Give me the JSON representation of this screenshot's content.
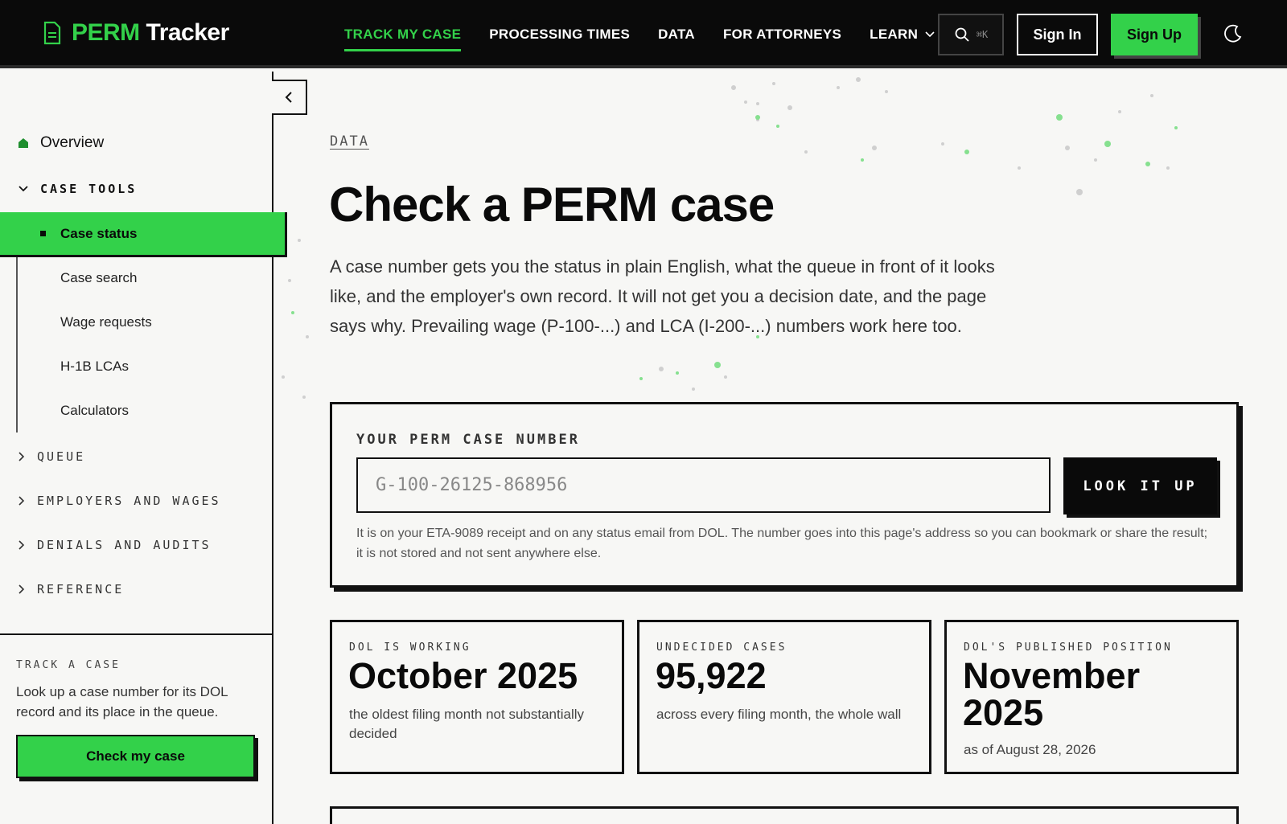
{
  "brand": {
    "part1": "PERM",
    "part2": "Tracker",
    "accent": "#33d14a"
  },
  "nav": {
    "items": [
      {
        "label": "TRACK MY CASE"
      },
      {
        "label": "PROCESSING TIMES"
      },
      {
        "label": "DATA"
      },
      {
        "label": "FOR ATTORNEYS"
      },
      {
        "label": "LEARN"
      }
    ],
    "search_shortcut": "⌘K",
    "sign_in": "Sign In",
    "sign_up": "Sign Up"
  },
  "sidebar": {
    "overview": "Overview",
    "case_tools": "CASE TOOLS",
    "case_tools_items": [
      "Case status",
      "Case search",
      "Wage requests",
      "H-1B LCAs",
      "Calculators"
    ],
    "sections": [
      "QUEUE",
      "EMPLOYERS AND WAGES",
      "DENIALS AND AUDITS",
      "REFERENCE"
    ],
    "cta": {
      "title": "TRACK A CASE",
      "text": "Look up a case number for its DOL record and its place in the queue.",
      "button": "Check my case"
    }
  },
  "main": {
    "eyebrow": "DATA",
    "title": "Check a PERM case",
    "intro": "A case number gets you the status in plain English, what the queue in front of it looks like, and the employer's own record. It will not get you a decision date, and the page says why. Prevailing wage (P-100-...) and LCA (I-200-...) numbers work here too.",
    "lookup": {
      "label": "YOUR PERM CASE NUMBER",
      "placeholder": "G-100-26125-868956",
      "button": "LOOK IT UP",
      "help": "It is on your ETA-9089 receipt and on any status email from DOL. The number goes into this page's address so you can bookmark or share the result; it is not stored and not sent anywhere else."
    },
    "stats": [
      {
        "label": "DOL IS WORKING",
        "value": "October 2025",
        "note": "the oldest filing month not substantially decided"
      },
      {
        "label": "UNDECIDED CASES",
        "value": "95,922",
        "note": "across every filing month, the whole wall"
      },
      {
        "label": "DOL'S PUBLISHED POSITION",
        "value": "November 2025",
        "note": "as of August 28, 2026"
      }
    ]
  }
}
